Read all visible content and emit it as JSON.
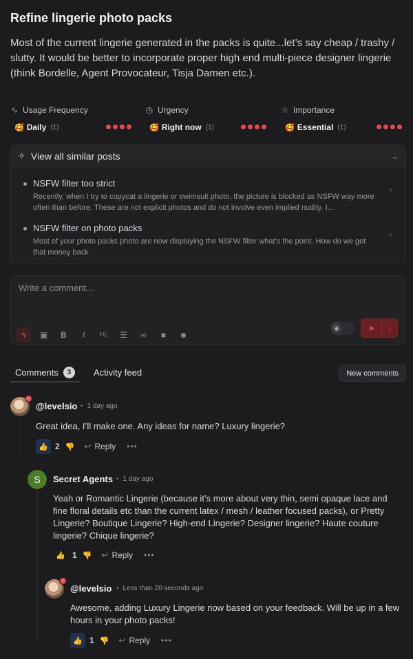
{
  "post": {
    "title": "Refine lingerie photo packs",
    "description": "Most of the current lingerie generated in the packs is quite...let’s say cheap / trashy / slutty. It would be better to incorporate proper high end multi-piece designer lingerie (think Bordelle, Agent Provocateur, Tisja Damen etc.)."
  },
  "meta": [
    {
      "label": "Usage Frequency",
      "icon": "pulse-icon",
      "emoji": "🥰",
      "value": "Daily",
      "count": "(1)",
      "dots": 4
    },
    {
      "label": "Urgency",
      "icon": "clock-icon",
      "emoji": "🥰",
      "value": "Right now",
      "count": "(1)",
      "dots": 4
    },
    {
      "label": "Importance",
      "icon": "star-icon",
      "emoji": "🥰",
      "value": "Essential",
      "count": "(1)",
      "dots": 4
    }
  ],
  "similar": {
    "heading": "View all similar posts",
    "items": [
      {
        "title": "NSFW filter too strict",
        "body": "Recently, when I try to copycat a lingerie or swimsuit photo, the picture is blocked as NSFW way more often than before. These are not explicit photos and do not involve even implied nudity. I..."
      },
      {
        "title": "NSFW filter on photo packs",
        "body": "Most of your photo packs photo are now displaying the NSFW filter what's the point. How do we get that money back"
      }
    ]
  },
  "composer": {
    "placeholder": "Write a comment..."
  },
  "tabs": {
    "comments": "Comments",
    "comments_count": "3",
    "activity": "Activity feed",
    "new_comments": "New comments"
  },
  "comments": [
    {
      "author": "@levelsio",
      "time": "1 day ago",
      "body": "Great idea, I’ll make one. Any ideas for name? Luxury lingerie?",
      "likes": "2",
      "reply": "Reply",
      "more": "•••"
    },
    {
      "author": "Secret Agents",
      "avatar_letter": "S",
      "time": "1 day ago",
      "body": "Yeah or Romantic Lingerie (because it’s more about very thin, semi opaque lace and fine floral details etc than the current latex / mesh / leather focused packs), or Pretty Lingerie? Boutique Lingerie? High-end Lingerie? Designer lingerie? Haute couture lingerie? Chique lingerie?",
      "likes": "1",
      "reply": "Reply",
      "more": "•••"
    },
    {
      "author": "@levelsio",
      "time": "Less than 20 seconds ago",
      "body": "Awesome, adding Luxury Lingerie now based on your feedback. Will be up in a few hours in your photo packs!",
      "likes": "1",
      "reply": "Reply",
      "more": "•••"
    }
  ],
  "colors": {
    "accent": "#e5484d",
    "like_active": "#6aa3ff",
    "background": "#1c1c1e"
  }
}
